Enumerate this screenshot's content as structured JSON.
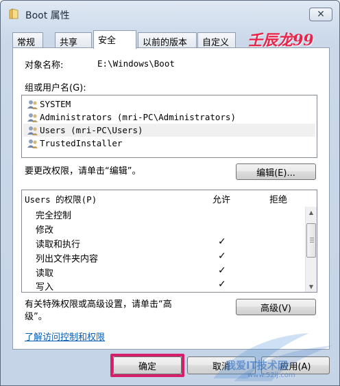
{
  "window": {
    "title": "Boot 属性",
    "close_glyph": "✕"
  },
  "tabs": [
    {
      "label": "常规"
    },
    {
      "label": "共享"
    },
    {
      "label": "安全"
    },
    {
      "label": "以前的版本"
    },
    {
      "label": "自定义"
    }
  ],
  "brand": "壬辰龙99",
  "security": {
    "object_label": "对象名称:",
    "object_value": "E:\\Windows\\Boot",
    "group_label": "组或用户名(G):",
    "users": [
      {
        "name": "SYSTEM"
      },
      {
        "name": "Administrators (mri-PC\\Administrators)"
      },
      {
        "name": "Users (mri-PC\\Users)"
      },
      {
        "name": "TrustedInstaller"
      }
    ],
    "change_hint": "要更改权限，请单击“编辑”。",
    "edit_button": "编辑(E)...",
    "perm_header": "Users 的权限(P)",
    "allow_header": "允许",
    "deny_header": "拒绝",
    "permissions": [
      {
        "name": "完全控制",
        "allow": ""
      },
      {
        "name": "修改",
        "allow": ""
      },
      {
        "name": "读取和执行",
        "allow": "✓"
      },
      {
        "name": "列出文件夹内容",
        "allow": "✓"
      },
      {
        "name": "读取",
        "allow": "✓"
      },
      {
        "name": "写入",
        "allow": "✓"
      }
    ],
    "advanced_hint_line1": "有关特殊权限或高级设置，请单击“高",
    "advanced_hint_line2": "级”。",
    "advanced_button": "高级(V)",
    "learn_link": "了解访问控制和权限"
  },
  "footer": {
    "ok_button": "确定",
    "cancel_button": "取消",
    "apply_button": "应用(A)"
  },
  "watermark": {
    "text": "我爱IT技术网",
    "url": "www.52ij.com"
  },
  "colors": {
    "brand": "#e8254a",
    "highlight": "#d61f69",
    "link": "#0a5db6"
  }
}
